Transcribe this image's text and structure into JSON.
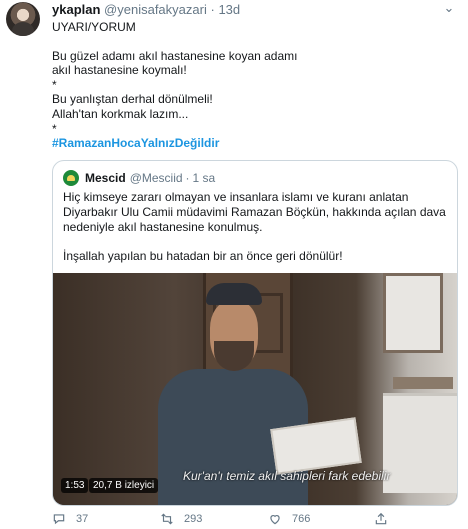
{
  "tweet": {
    "name": "ykaplan",
    "handle": "@yenisafakyazari",
    "separator": "·",
    "time": "13d",
    "lines": [
      "UYARI/YORUM",
      "",
      "Bu güzel adamı akıl hastanesine koyan adamı",
      "akıl hastanesine koymalı!",
      "*",
      "Bu yanlıştan derhal dönülmeli!",
      "Allah'tan korkmak lazım...",
      "*"
    ],
    "hashtag": "#RamazanHocaYalnızDeğildir"
  },
  "quote": {
    "name": "Mescid",
    "handle": "@Mesciid",
    "separator": "·",
    "time": "1 sa",
    "lines": [
      "Hiç kimseye zararı olmayan ve insanlara islamı ve kuranı anlatan",
      "Diyarbakır Ulu Camii müdavimi Ramazan Böçkün, hakkında açılan dava",
      "nedeniyle akıl hastanesine konulmuş.",
      "",
      "İnşallah yapılan bu hatadan bir an önce geri dönülür!"
    ],
    "video": {
      "subtitle": "Kur'an'ı temiz akıl sahipleri fark edebilir",
      "duration": "1:53",
      "views": "20,7 B izleyici"
    }
  },
  "actions": {
    "reply_count": "37",
    "retweet_count": "293",
    "like_count": "766",
    "icons": [
      "reply-icon",
      "retweet-icon",
      "like-icon",
      "share-icon"
    ]
  },
  "colors": {
    "hashtag": "#1b95e0",
    "secondary_text": "#657786",
    "border": "#ccd6dd"
  }
}
